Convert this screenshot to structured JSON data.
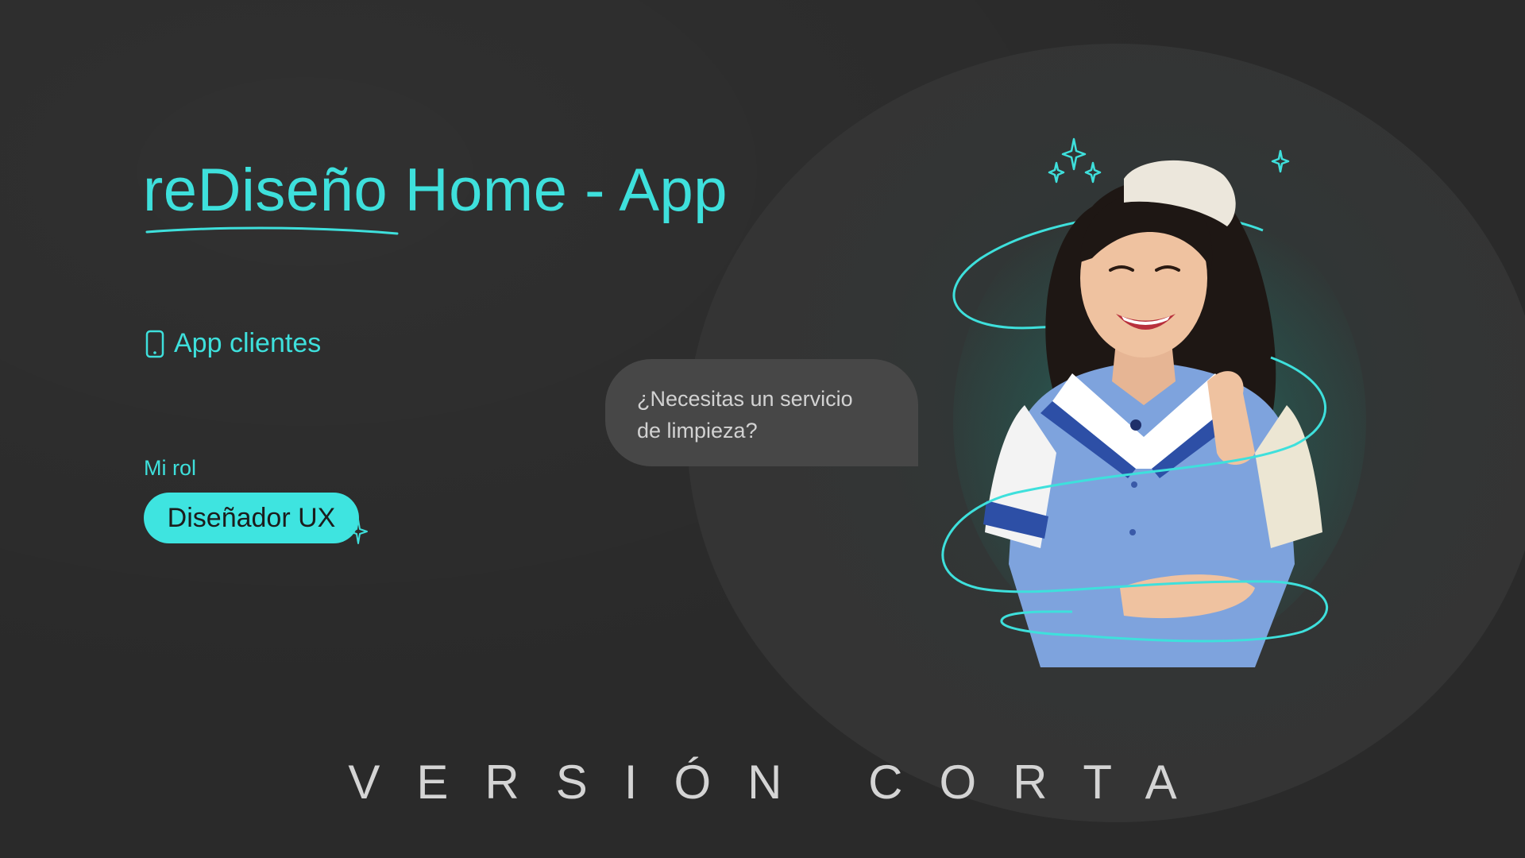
{
  "hero": {
    "title": "reDiseño Home - App"
  },
  "platform": {
    "icon": "smartphone-icon",
    "label": "App clientes"
  },
  "role": {
    "label": "Mi rol",
    "value": "Diseñador UX"
  },
  "chat": {
    "line1": "¿Necesitas un servicio",
    "line2": "de limpieza?"
  },
  "footer": {
    "label": "VERSIÓN CORTA"
  },
  "colors": {
    "accent": "#3ee0dc",
    "background": "#2a2a2a",
    "bubble": "#474747",
    "uniform": "#7aa0dc"
  }
}
